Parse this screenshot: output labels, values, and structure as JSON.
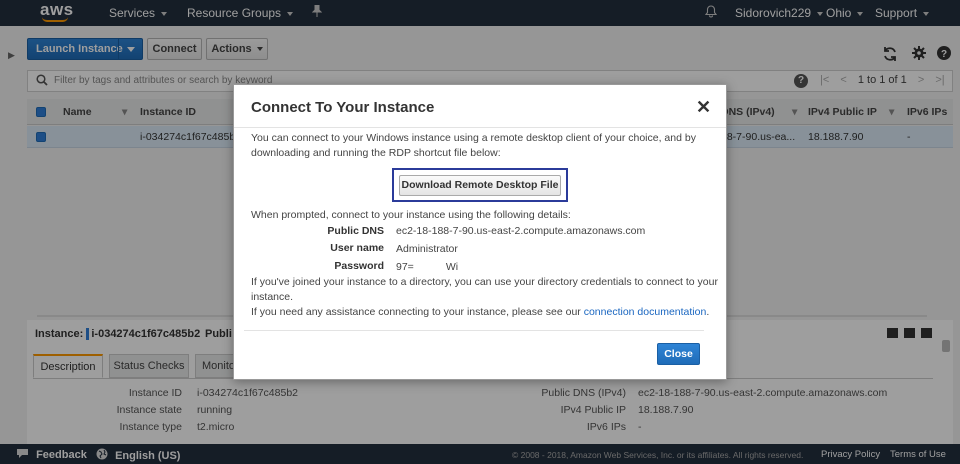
{
  "topnav": {
    "logo": "aws",
    "services": "Services",
    "resource_groups": "Resource Groups",
    "user": "Sidorovich229",
    "region": "Ohio",
    "support": "Support"
  },
  "toolbar": {
    "launch": "Launch Instance",
    "connect": "Connect",
    "actions": "Actions"
  },
  "filter": {
    "placeholder": "Filter by tags and attributes or search by keyword",
    "pager": "1 to 1 of 1"
  },
  "table": {
    "headers": {
      "name": "Name",
      "instance_id": "Instance ID",
      "public_dns": "DNS (IPv4)",
      "ipv4": "IPv4 Public IP",
      "ipv6": "IPv6 IPs"
    },
    "row": {
      "instance_id": "i-034274c1f67c485b2",
      "public_dns": "88-7-90.us-ea...",
      "ipv4": "18.188.7.90",
      "ipv6": "-"
    }
  },
  "lower": {
    "instance_label": "Instance:",
    "instance_id": "i-034274c1f67c485b2",
    "public_partial": "Publi",
    "tabs": [
      "Description",
      "Status Checks",
      "Monito"
    ],
    "left": [
      {
        "k": "Instance ID",
        "v": "i-034274c1f67c485b2"
      },
      {
        "k": "Instance state",
        "v": "running"
      },
      {
        "k": "Instance type",
        "v": "t2.micro"
      }
    ],
    "right": [
      {
        "k": "Public DNS (IPv4)",
        "v": "ec2-18-188-7-90.us-east-2.compute.amazonaws.com"
      },
      {
        "k": "IPv4 Public IP",
        "v": "18.188.7.90"
      },
      {
        "k": "IPv6 IPs",
        "v": "-"
      }
    ]
  },
  "modal": {
    "title": "Connect To Your Instance",
    "close_x": "✕",
    "intro1": "You can connect to your Windows instance using a remote desktop client of your choice, and by",
    "intro2": "downloading and running the RDP shortcut file below:",
    "download_button": "Download Remote Desktop File",
    "prompted": "When prompted, connect to your instance using the following details:",
    "details": {
      "dns_label": "Public DNS",
      "dns_value": "ec2-18-188-7-90.us-east-2.compute.amazonaws.com",
      "user_label": "User name",
      "user_value": "Administrator",
      "pass_label": "Password",
      "pass_value": "97=           Wi"
    },
    "directory1": "If you've joined your instance to a directory, you can use your directory credentials to connect to your",
    "directory2": "instance.",
    "help_text": "If you need any assistance connecting to your instance, please see our ",
    "help_link": "connection documentation",
    "help_end": ".",
    "close_button": "Close"
  },
  "footer": {
    "feedback": "Feedback",
    "language": "English (US)",
    "copyright": "© 2008 - 2018, Amazon Web Services, Inc. or its affiliates. All rights reserved.",
    "privacy": "Privacy Policy",
    "terms": "Terms of Use"
  },
  "colors": {
    "nav_bg": "#232f3e",
    "accent": "#f90",
    "primary": "#1f6cb8"
  }
}
